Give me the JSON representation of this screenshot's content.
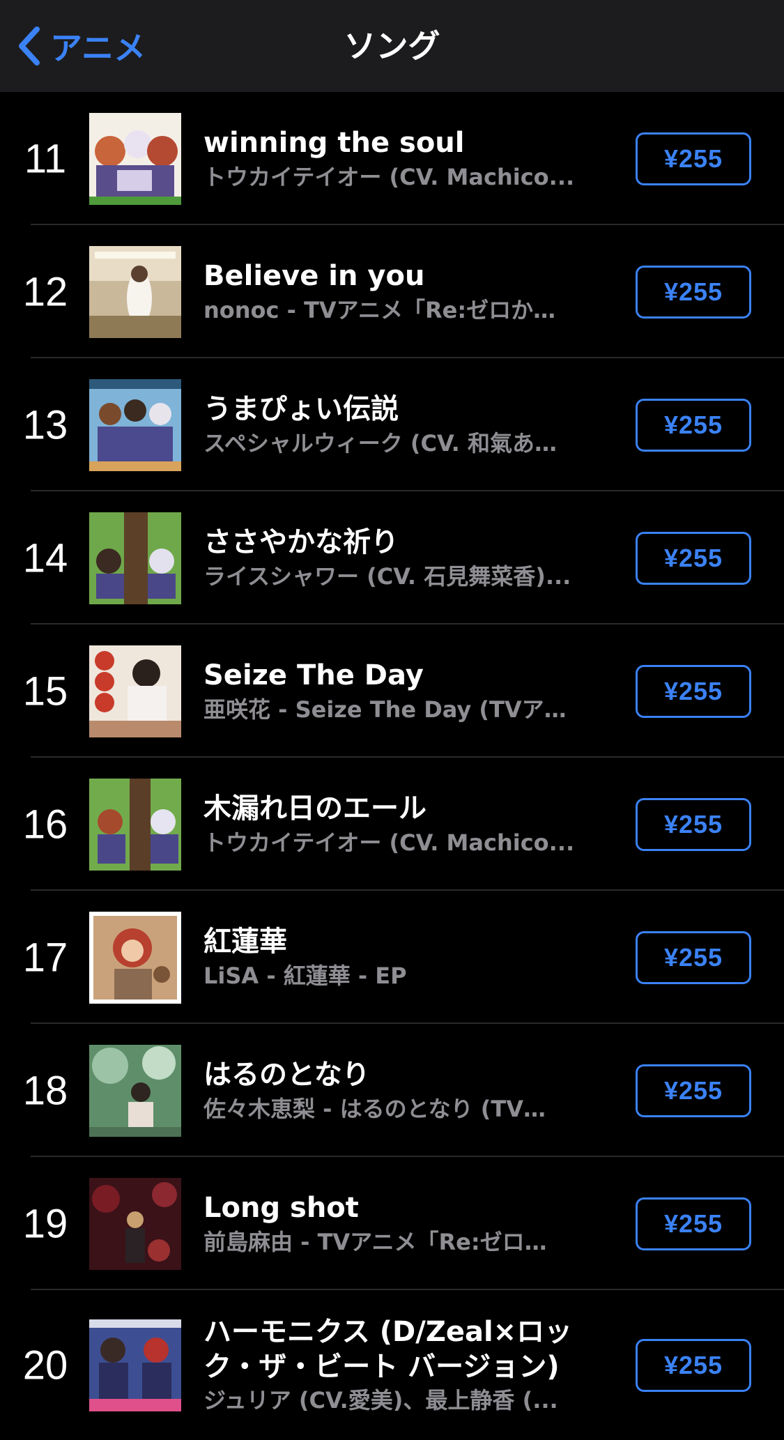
{
  "navbar": {
    "back_label": "アニメ",
    "title": "ソング"
  },
  "colors": {
    "accent": "#3b82f6",
    "background": "#000000",
    "navbar_bg": "#1c1c1e",
    "subtitle": "#8e8e93"
  },
  "songs": [
    {
      "rank": "11",
      "title": "winning the soul",
      "subtitle": "トウカイテイオー (CV. Machico...",
      "price": "¥255"
    },
    {
      "rank": "12",
      "title": "Believe in you",
      "subtitle": "nonoc - TVアニメ「Re:ゼロか…",
      "price": "¥255"
    },
    {
      "rank": "13",
      "title": "うまぴょい伝説",
      "subtitle": "スペシャルウィーク (CV. 和氣あ…",
      "price": "¥255"
    },
    {
      "rank": "14",
      "title": "ささやかな祈り",
      "subtitle": "ライスシャワー (CV. 石見舞菜香)...",
      "price": "¥255"
    },
    {
      "rank": "15",
      "title": "Seize The Day",
      "subtitle": "亜咲花 - Seize The Day (TVア…",
      "price": "¥255"
    },
    {
      "rank": "16",
      "title": "木漏れ日のエール",
      "subtitle": "トウカイテイオー (CV. Machico...",
      "price": "¥255"
    },
    {
      "rank": "17",
      "title": "紅蓮華",
      "subtitle": "LiSA - 紅蓮華 - EP",
      "price": "¥255"
    },
    {
      "rank": "18",
      "title": "はるのとなり",
      "subtitle": "佐々木恵梨 - はるのとなり (TV…",
      "price": "¥255"
    },
    {
      "rank": "19",
      "title": "Long shot",
      "subtitle": "前島麻由 - TVアニメ「Re:ゼロ…",
      "price": "¥255"
    },
    {
      "rank": "20",
      "title": "ハーモニクス (D/Zeal×ロック・ザ・ビート バージョン)",
      "subtitle": "ジュリア (CV.愛美)、最上静香 (...",
      "price": "¥255"
    }
  ]
}
